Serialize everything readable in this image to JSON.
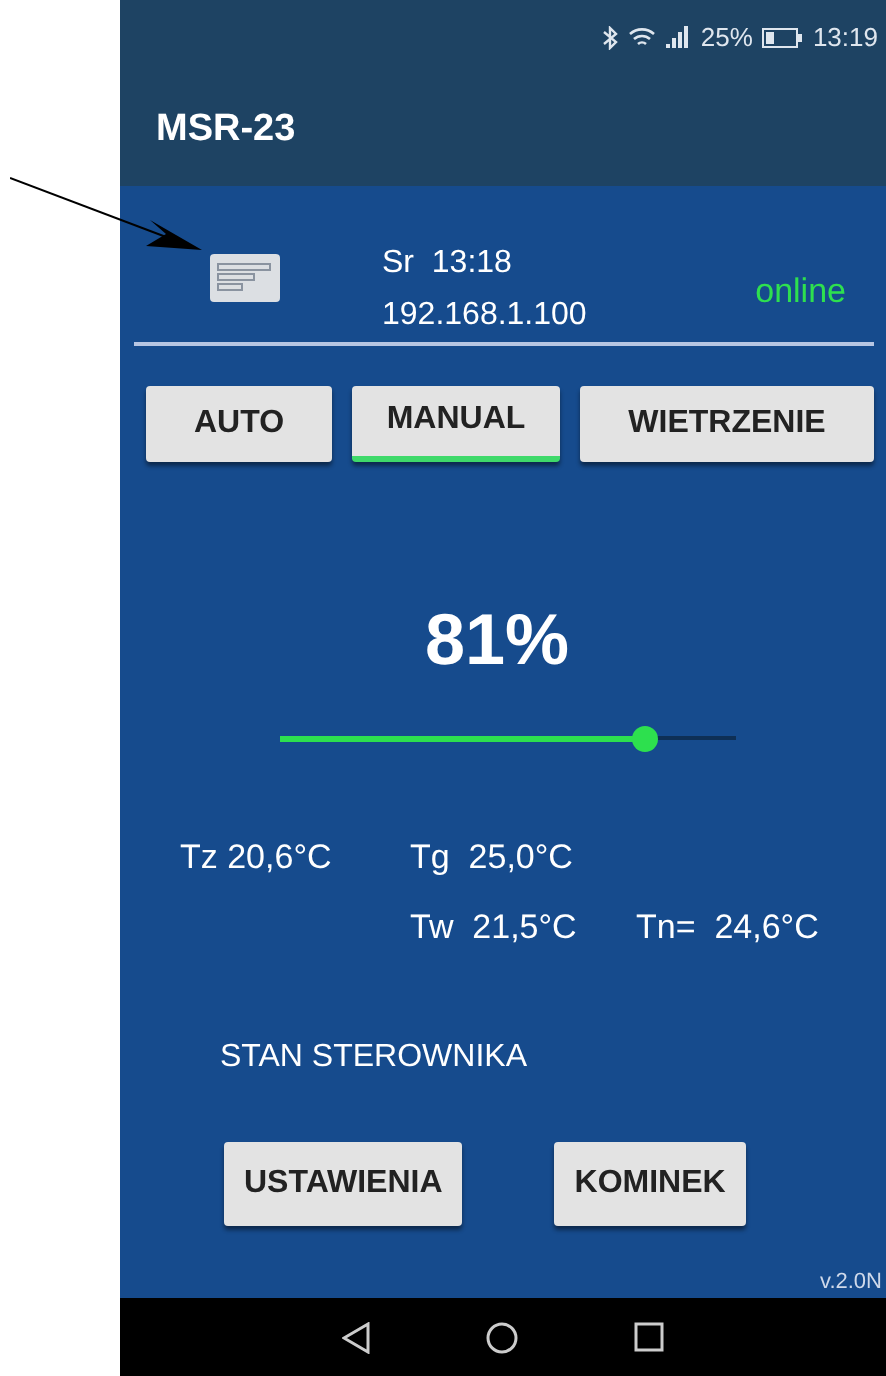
{
  "status_bar": {
    "battery_text": "25%",
    "time": "13:19"
  },
  "app_bar": {
    "title": "MSR-23"
  },
  "info": {
    "day_time": "Sr  13:18",
    "ip": "192.168.1.100",
    "connection": "online"
  },
  "modes": [
    {
      "label": "AUTO",
      "selected": false
    },
    {
      "label": "MANUAL",
      "selected": true
    },
    {
      "label": "WIETRZENIE",
      "selected": false
    }
  ],
  "power": {
    "reading": "81%",
    "level": 0.8
  },
  "temperature_rows": [
    [
      "Tz 20,6°C",
      "Tg  25,0°C"
    ],
    [
      "Tw  21,5°C",
      "Tn=  24,6°C"
    ]
  ],
  "status_label": "STAN STEROWNIKA",
  "buttons": [
    "USTAWIENIA",
    "KOMINEK"
  ],
  "version": "v.2.0N"
}
